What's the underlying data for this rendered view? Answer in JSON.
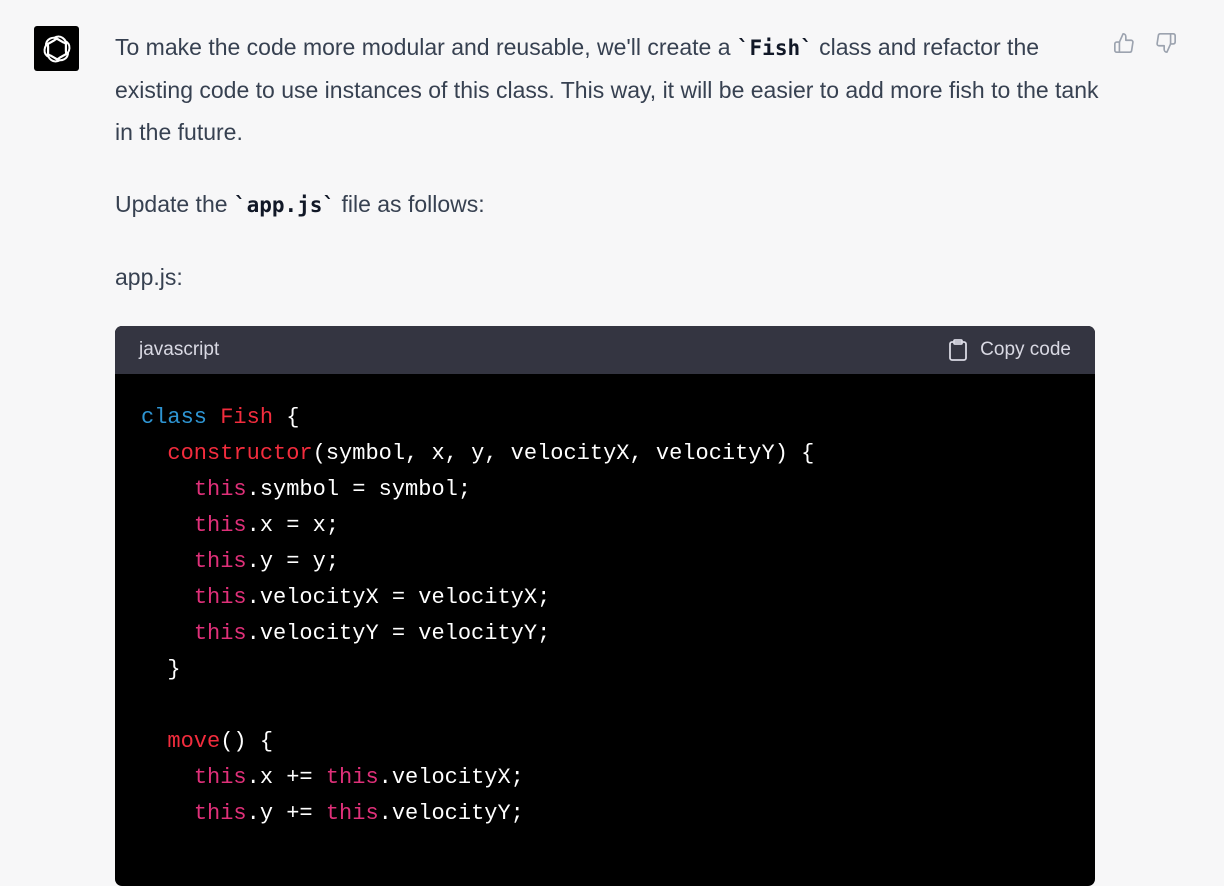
{
  "message": {
    "para1": {
      "before": "To make the code more modular and reusable, we'll create a ",
      "code": "`Fish`",
      "after": " class and refactor the existing code to use instances of this class. This way, it will be easier to add more fish to the tank in the future."
    },
    "para2": {
      "before": "Update the ",
      "code": "`app.js`",
      "after": " file as follows:"
    },
    "para3": "app.js:"
  },
  "code_block": {
    "language": "javascript",
    "copy_label": "Copy code",
    "lines": [
      [
        {
          "t": "class",
          "c": "kw"
        },
        {
          "t": " "
        },
        {
          "t": "Fish",
          "c": "cls"
        },
        {
          "t": " {"
        }
      ],
      [
        {
          "t": "  "
        },
        {
          "t": "constructor",
          "c": "fn"
        },
        {
          "t": "(symbol, x, y, velocityX, velocityY) {"
        }
      ],
      [
        {
          "t": "    "
        },
        {
          "t": "this",
          "c": "this"
        },
        {
          "t": ".symbol = symbol;"
        }
      ],
      [
        {
          "t": "    "
        },
        {
          "t": "this",
          "c": "this"
        },
        {
          "t": ".x = x;"
        }
      ],
      [
        {
          "t": "    "
        },
        {
          "t": "this",
          "c": "this"
        },
        {
          "t": ".y = y;"
        }
      ],
      [
        {
          "t": "    "
        },
        {
          "t": "this",
          "c": "this"
        },
        {
          "t": ".velocityX = velocityX;"
        }
      ],
      [
        {
          "t": "    "
        },
        {
          "t": "this",
          "c": "this"
        },
        {
          "t": ".velocityY = velocityY;"
        }
      ],
      [
        {
          "t": "  }"
        }
      ],
      [
        {
          "t": ""
        }
      ],
      [
        {
          "t": "  "
        },
        {
          "t": "move",
          "c": "fn"
        },
        {
          "t": "() {"
        }
      ],
      [
        {
          "t": "    "
        },
        {
          "t": "this",
          "c": "this"
        },
        {
          "t": ".x += "
        },
        {
          "t": "this",
          "c": "this"
        },
        {
          "t": ".velocityX;"
        }
      ],
      [
        {
          "t": "    "
        },
        {
          "t": "this",
          "c": "this"
        },
        {
          "t": ".y += "
        },
        {
          "t": "this",
          "c": "this"
        },
        {
          "t": ".velocityY;"
        }
      ]
    ]
  },
  "icons": {
    "avatar": "openai-logo-icon",
    "thumbs_up": "thumbs-up-icon",
    "thumbs_down": "thumbs-down-icon",
    "copy": "clipboard-icon"
  },
  "colors": {
    "page_bg": "#f7f7f8",
    "code_bg": "#000000",
    "code_header_bg": "#343541",
    "keyword": "#2e95d3",
    "class_name": "#f22c3d",
    "this": "#df3079"
  }
}
